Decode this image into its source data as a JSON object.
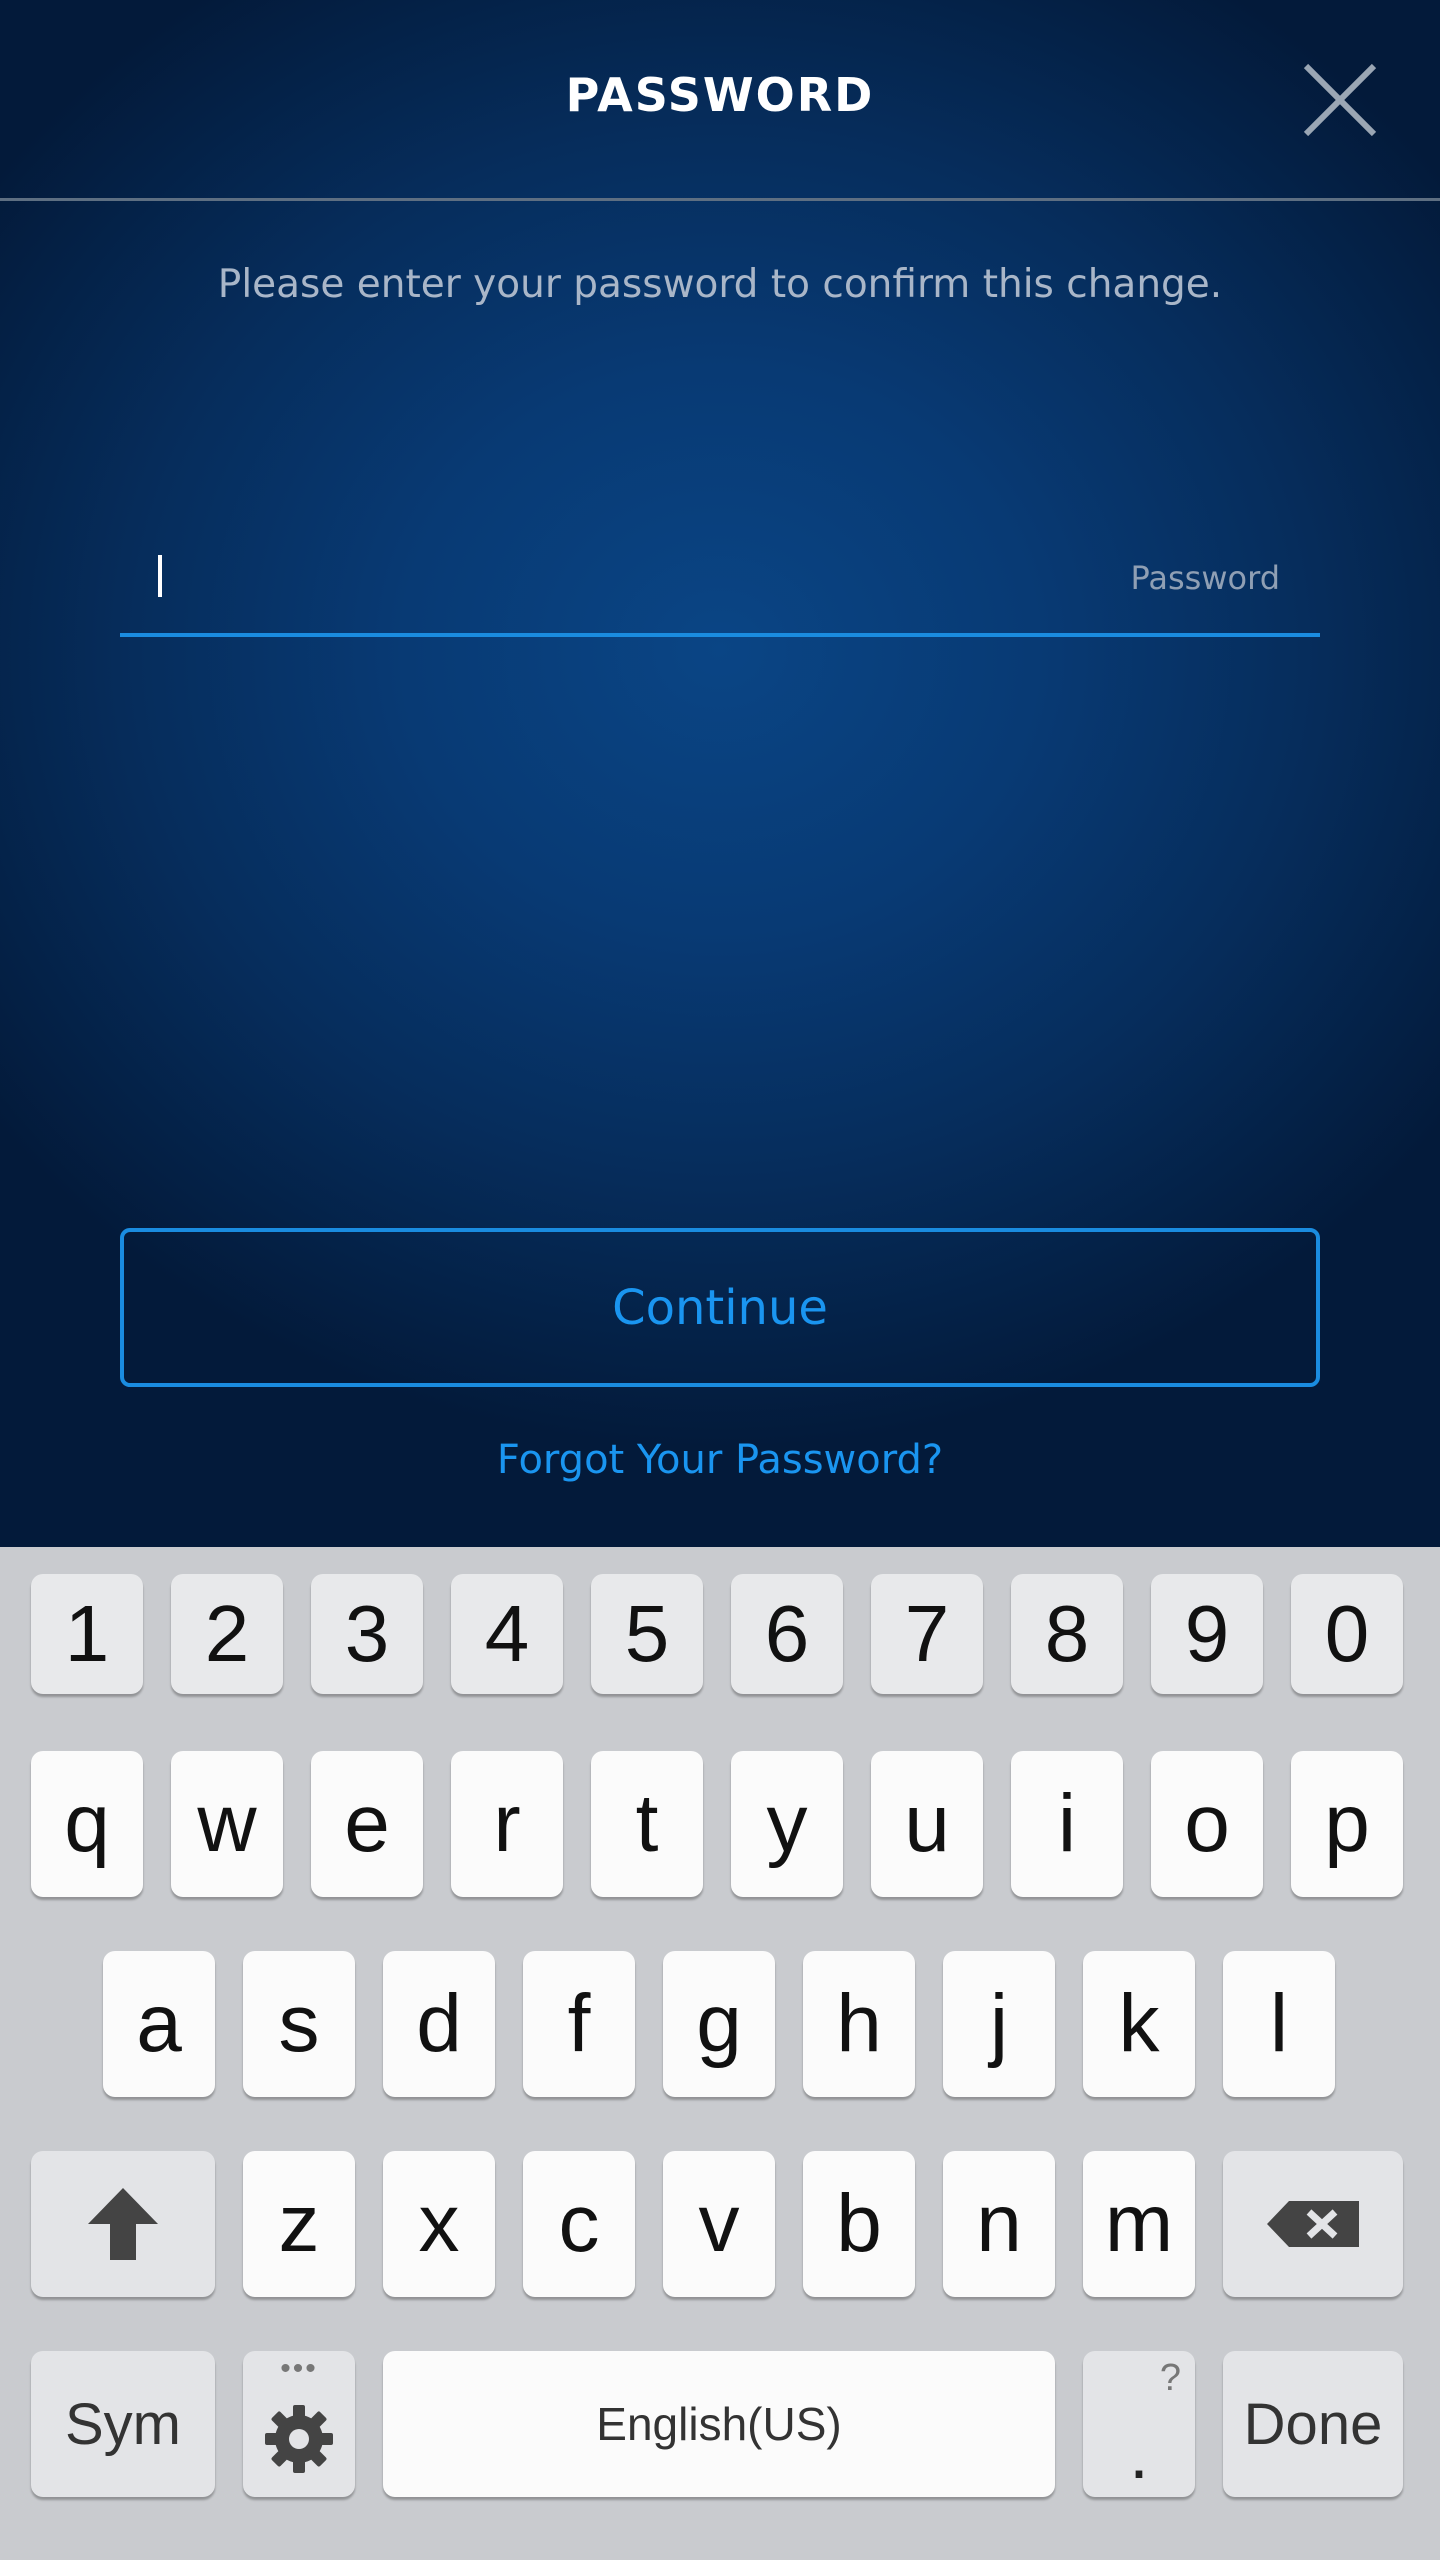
{
  "header": {
    "title": "PASSWORD",
    "close_icon": "close-icon"
  },
  "main": {
    "instruction": "Please enter your password to confirm this change.",
    "password_field": {
      "value": "",
      "hint": "Password"
    },
    "continue_label": "Continue",
    "forgot_label": "Forgot Your Password?"
  },
  "colors": {
    "accent": "#1a8ce0",
    "background": "#083a74",
    "keyboard_bg": "#c9cbcf"
  },
  "keyboard": {
    "number_row": [
      "1",
      "2",
      "3",
      "4",
      "5",
      "6",
      "7",
      "8",
      "9",
      "0"
    ],
    "row1": [
      "q",
      "w",
      "e",
      "r",
      "t",
      "y",
      "u",
      "i",
      "o",
      "p"
    ],
    "row2": [
      "a",
      "s",
      "d",
      "f",
      "g",
      "h",
      "j",
      "k",
      "l"
    ],
    "row3": [
      "z",
      "x",
      "c",
      "v",
      "b",
      "n",
      "m"
    ],
    "sym_label": "Sym",
    "space_label": "English(US)",
    "period_label": ".",
    "period_alt": "?",
    "done_label": "Done",
    "shift_icon": "shift-arrow-icon",
    "backspace_icon": "backspace-icon",
    "settings_icon": "gear-icon"
  }
}
